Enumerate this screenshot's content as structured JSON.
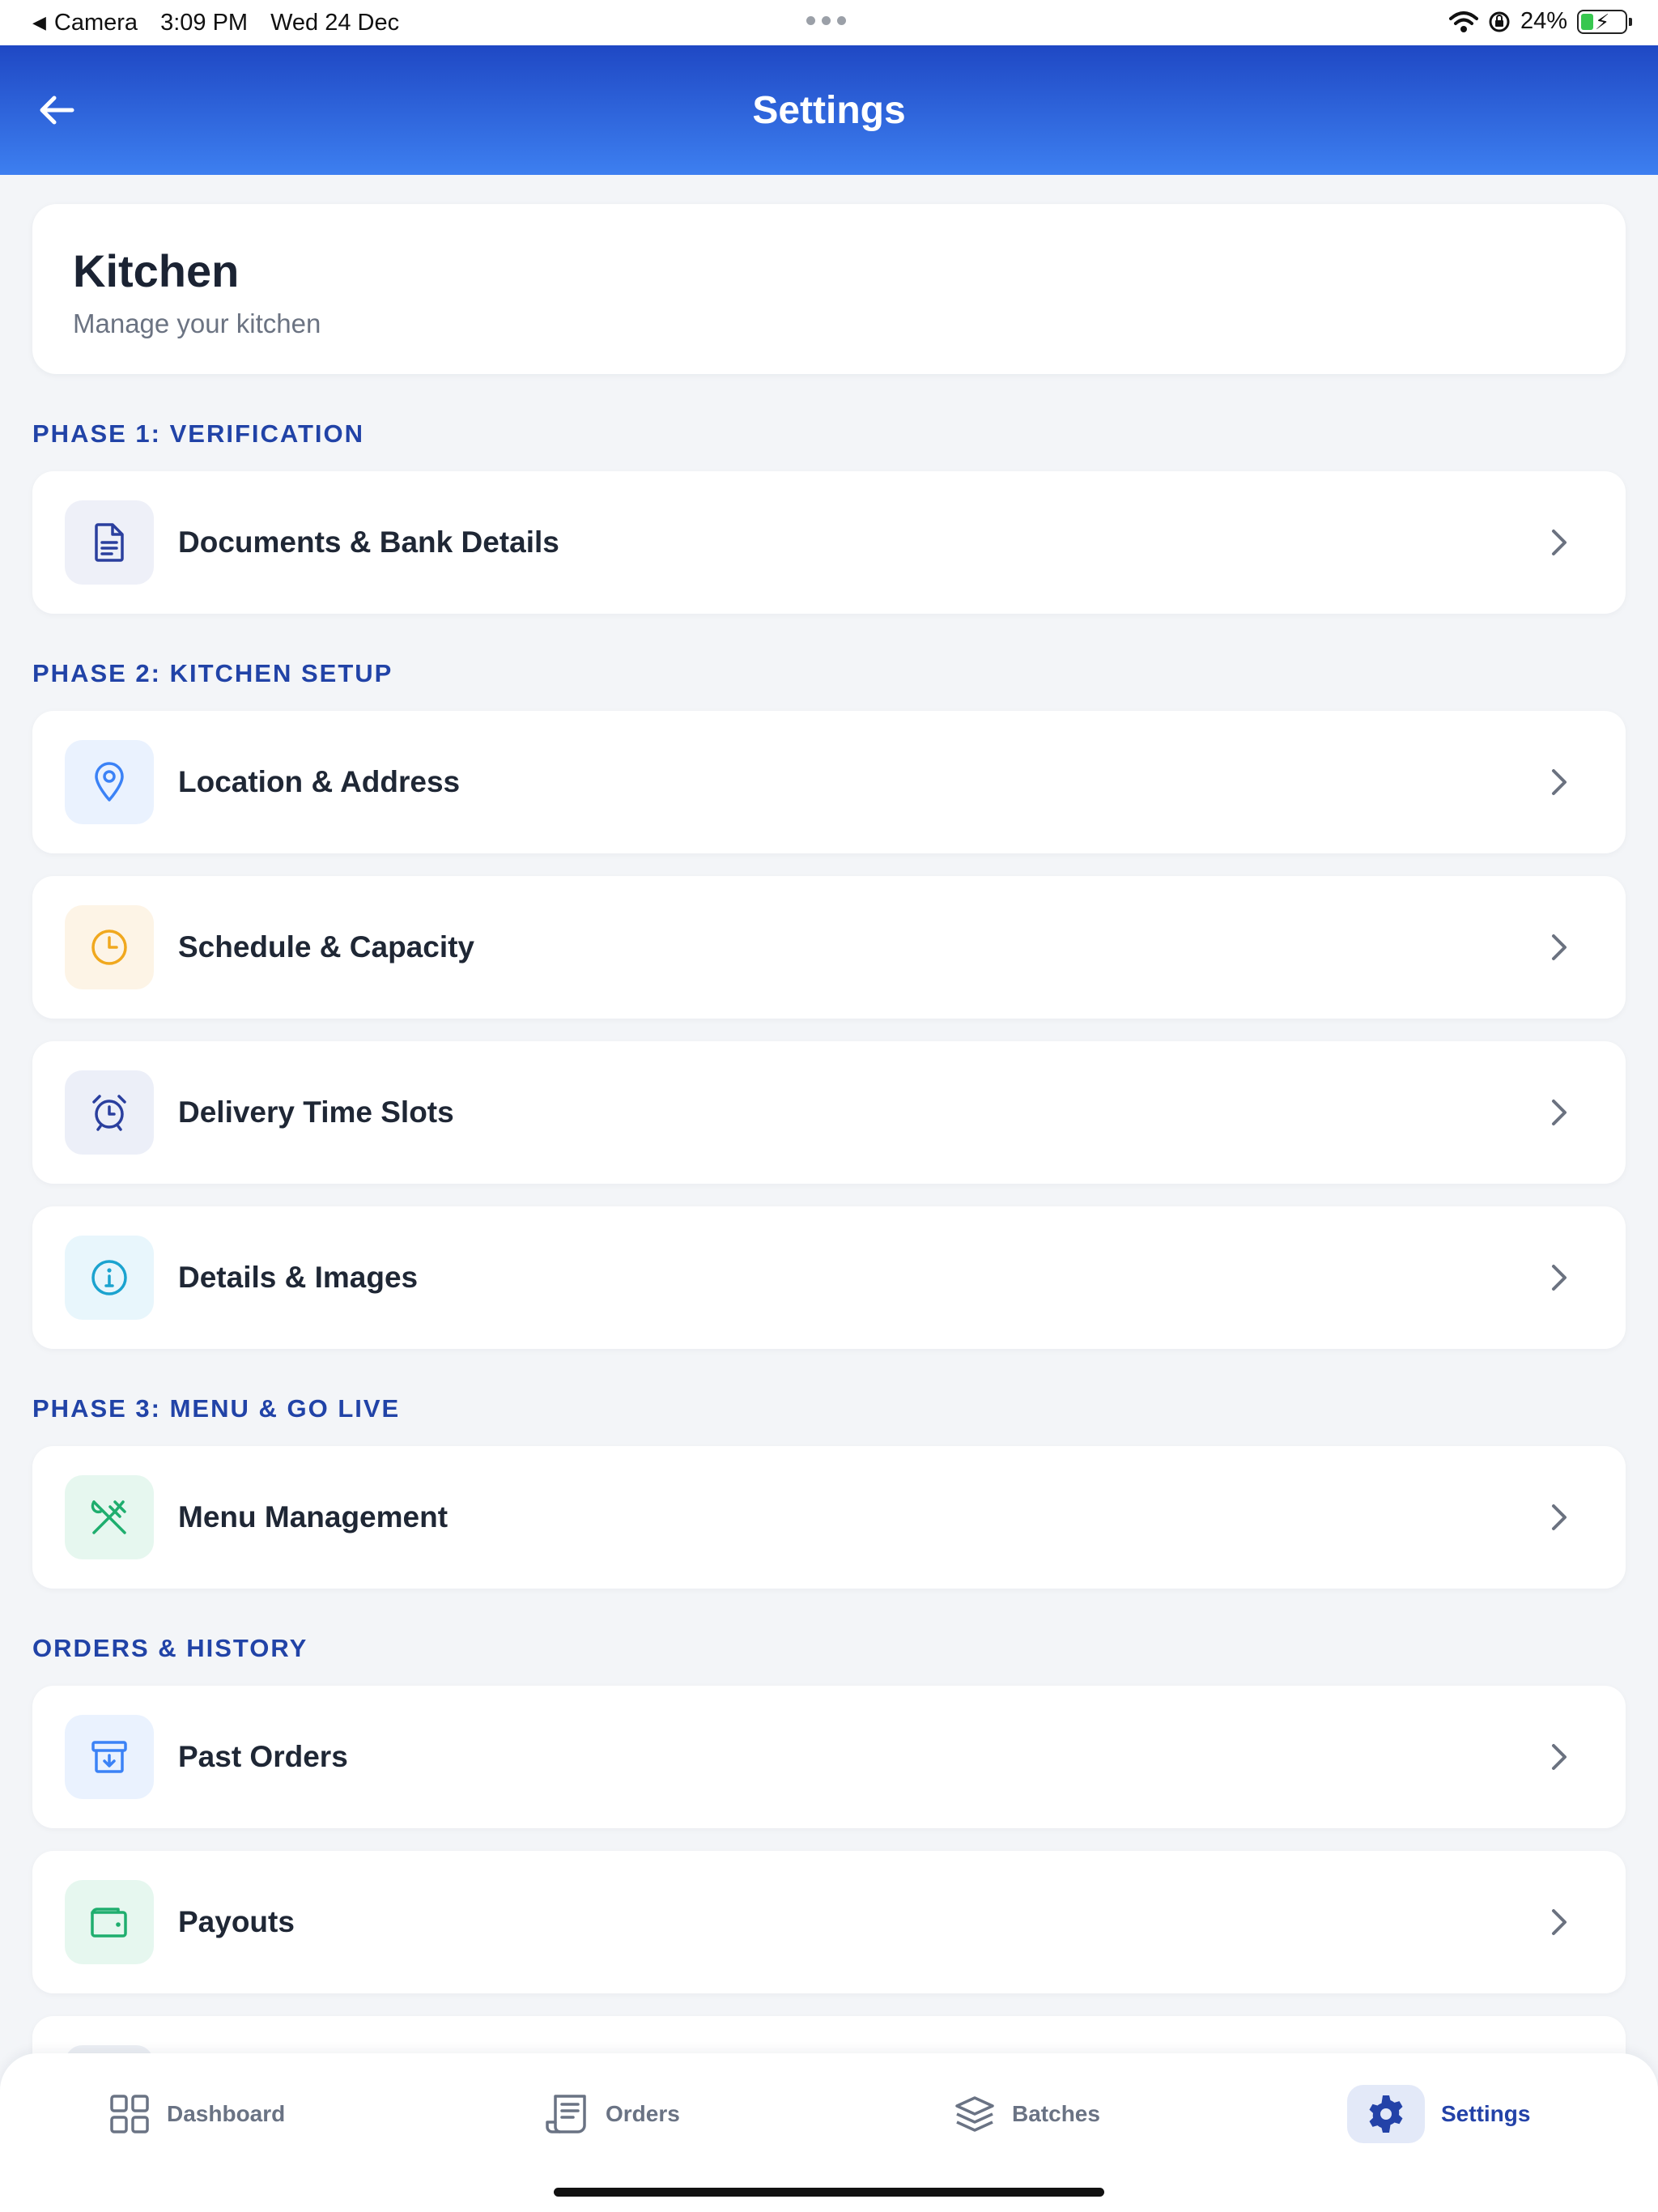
{
  "status_bar": {
    "back_app": "Camera",
    "time": "3:09 PM",
    "date": "Wed 24 Dec",
    "battery": "24%"
  },
  "header": {
    "title": "Settings"
  },
  "kitchen": {
    "title": "Kitchen",
    "subtitle": "Manage your kitchen"
  },
  "sections": {
    "phase1": "PHASE 1: VERIFICATION",
    "phase2": "PHASE 2: KITCHEN SETUP",
    "phase3": "PHASE 3: MENU & GO LIVE",
    "orders": "ORDERS & HISTORY"
  },
  "items": {
    "documents": "Documents & Bank Details",
    "location": "Location & Address",
    "schedule": "Schedule & Capacity",
    "delivery": "Delivery Time Slots",
    "details": "Details & Images",
    "menu": "Menu Management",
    "past_orders": "Past Orders",
    "payouts": "Payouts"
  },
  "icons": {
    "documents": "document-icon",
    "location": "location-pin-icon",
    "schedule": "clock-icon",
    "delivery": "alarm-clock-icon",
    "details": "info-icon",
    "menu": "utensils-icon",
    "past_orders": "archive-icon",
    "payouts": "wallet-icon"
  },
  "nav": {
    "dashboard": "Dashboard",
    "orders": "Orders",
    "batches": "Batches",
    "settings": "Settings",
    "active": "settings"
  },
  "colors": {
    "header_gradient_top": "#1f48c4",
    "header_gradient_bottom": "#3d7ff0",
    "section_label": "#2143a7",
    "accent_blue": "#2342a8"
  }
}
